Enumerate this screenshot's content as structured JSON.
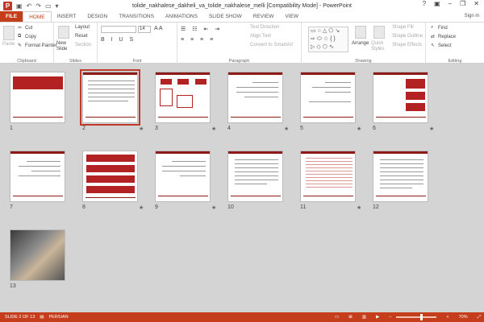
{
  "window": {
    "title": "tolide_nakhalese_dakheli_va_tolide_nakhalese_melli [Compatibility Mode] - PowerPoint",
    "sign_in": "Sign in"
  },
  "tabs": [
    "FILE",
    "HOME",
    "INSERT",
    "DESIGN",
    "TRANSITIONS",
    "ANIMATIONS",
    "SLIDE SHOW",
    "REVIEW",
    "VIEW"
  ],
  "active_tab": "HOME",
  "ribbon": {
    "clipboard": {
      "label": "Clipboard",
      "paste": "Paste",
      "cut": "Cut",
      "copy": "Copy",
      "format_painter": "Format Painter"
    },
    "slides": {
      "label": "Slides",
      "new_slide": "New Slide",
      "layout": "Layout",
      "reset": "Reset",
      "section": "Section"
    },
    "font": {
      "label": "Font",
      "size": "14"
    },
    "paragraph": {
      "label": "Paragraph",
      "text_direction": "Text Direction",
      "align_text": "Align Text",
      "convert": "Convert to SmartArt"
    },
    "drawing": {
      "label": "Drawing",
      "arrange": "Arrange",
      "quick_styles": "Quick Styles",
      "shape_fill": "Shape Fill",
      "shape_outline": "Shape Outline",
      "shape_effects": "Shape Effects"
    },
    "editing": {
      "label": "Editing",
      "find": "Find",
      "replace": "Replace",
      "select": "Select"
    }
  },
  "slides": [
    {
      "n": "1",
      "star": false
    },
    {
      "n": "2",
      "star": true
    },
    {
      "n": "3",
      "star": true
    },
    {
      "n": "4",
      "star": true
    },
    {
      "n": "5",
      "star": true
    },
    {
      "n": "6",
      "star": true
    },
    {
      "n": "7",
      "star": false
    },
    {
      "n": "8",
      "star": true
    },
    {
      "n": "9",
      "star": true
    },
    {
      "n": "10",
      "star": false
    },
    {
      "n": "11",
      "star": true
    },
    {
      "n": "12",
      "star": false
    },
    {
      "n": "13",
      "star": false
    }
  ],
  "status": {
    "slide": "SLIDE 2 OF 13",
    "language": "PERSIAN",
    "zoom": "70%"
  },
  "colors": {
    "accent": "#c43e1c",
    "theme_red": "#8b1a1a"
  }
}
